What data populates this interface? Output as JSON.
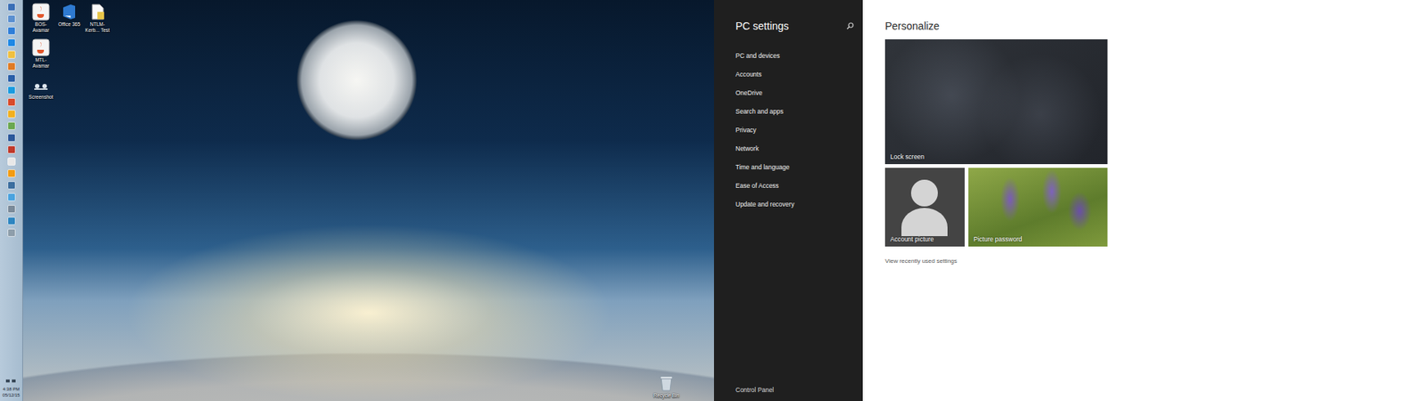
{
  "taskbar": {
    "apps": [
      {
        "color": "#3b6fb6"
      },
      {
        "color": "#5a8fd0"
      },
      {
        "color": "#2f7ed8"
      },
      {
        "color": "#1e88e5"
      },
      {
        "color": "#f0c040"
      },
      {
        "color": "#e07b24"
      },
      {
        "color": "#2a5fa8"
      },
      {
        "color": "#1a9be0"
      },
      {
        "color": "#d94a2a"
      },
      {
        "color": "#f2b01e"
      },
      {
        "color": "#6aa84f"
      },
      {
        "color": "#2b579a"
      },
      {
        "color": "#c0392b"
      },
      {
        "color": "#e8e8e8"
      },
      {
        "color": "#f39c12"
      },
      {
        "color": "#3c6e9f"
      },
      {
        "color": "#4aa3df"
      },
      {
        "color": "#7a8a99"
      },
      {
        "color": "#2e86c1"
      },
      {
        "color": "#8e9eab"
      }
    ],
    "clock": {
      "time": "4:38 PM",
      "date": "05/12/15"
    }
  },
  "desktop": {
    "icons": [
      {
        "label": "BOS-Avamar",
        "kind": "app"
      },
      {
        "label": "Office 365",
        "kind": "office"
      },
      {
        "label": "NTLM-Kerb... Test",
        "kind": "document"
      },
      {
        "label": "MTL-Avamar",
        "kind": "app"
      },
      {
        "label": "Screenshot",
        "kind": "shortcut"
      }
    ],
    "recycle_bin": {
      "label": "Recycle Bin"
    }
  },
  "sidebar": {
    "title": "PC settings",
    "items": [
      "PC and devices",
      "Accounts",
      "OneDrive",
      "Search and apps",
      "Privacy",
      "Network",
      "Time and language",
      "Ease of Access",
      "Update and recovery"
    ],
    "footer": "Control Panel"
  },
  "content": {
    "heading": "Personalize",
    "tiles": [
      {
        "label": "Lock screen",
        "kind": "lock"
      },
      {
        "label": "Account picture",
        "kind": "account"
      },
      {
        "label": "Picture password",
        "kind": "picture"
      }
    ],
    "link": "View recently used settings"
  }
}
